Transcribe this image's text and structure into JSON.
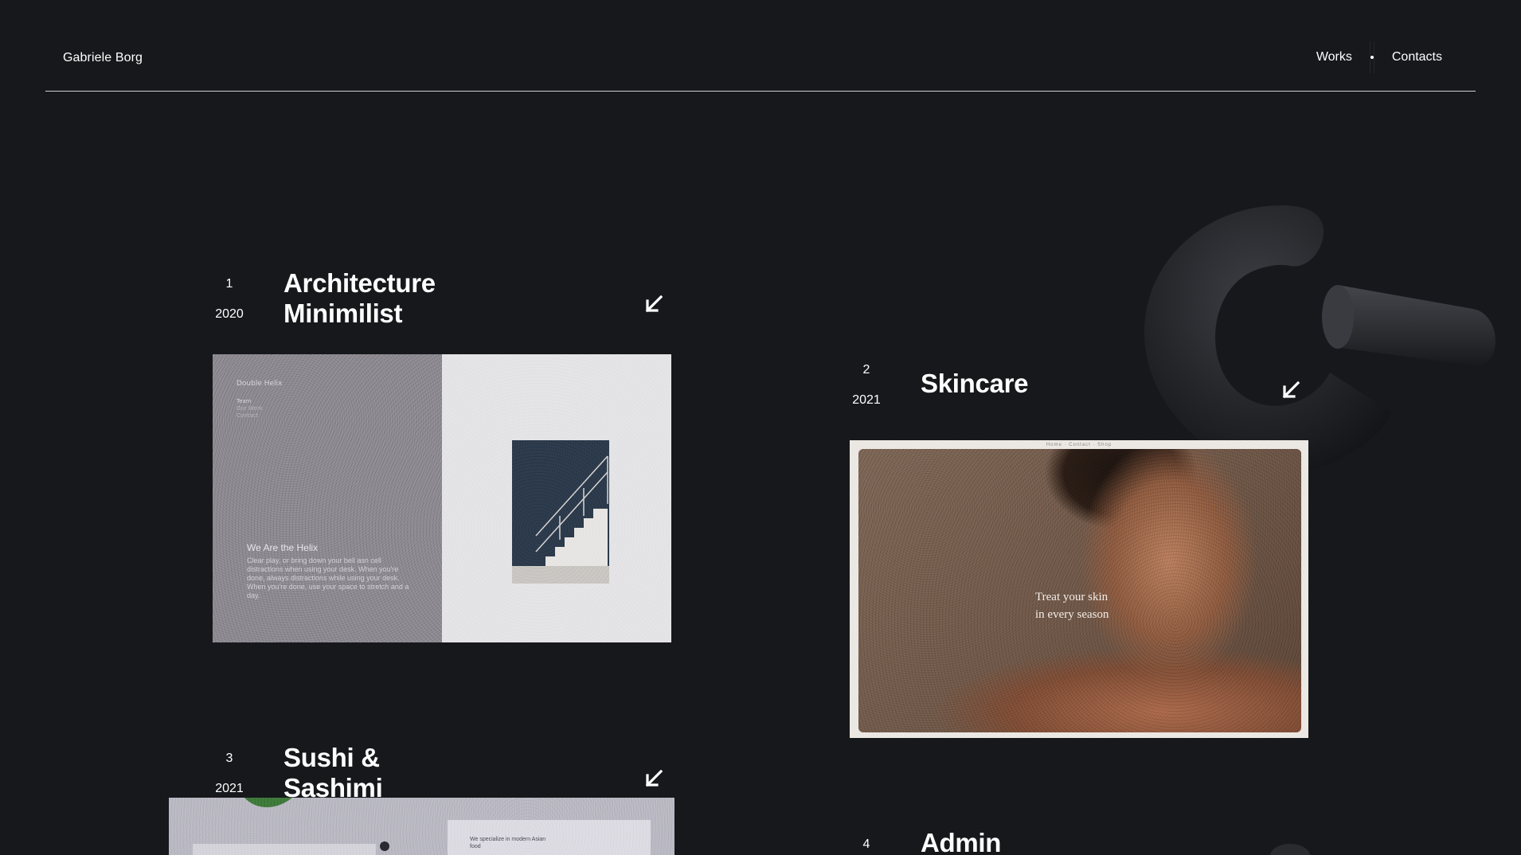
{
  "header": {
    "brand": "Gabriele Borg",
    "nav": [
      {
        "label": "Works"
      },
      {
        "label": "Contacts"
      }
    ]
  },
  "projects": [
    {
      "number": "1",
      "year": "2020",
      "title_lines": [
        "Architecture",
        "Minimilist"
      ],
      "thumb": {
        "brand": "Double Helix",
        "menu": [
          "Team",
          "Our Work",
          "Contact"
        ],
        "heading": "We Are the Helix",
        "body": "Clear play, or bring down your bell asn cell distractions when using your desk. When you're done, always distractions while using your desk. When you're done, use your space to stretch and a day."
      }
    },
    {
      "number": "2",
      "year": "2021",
      "title_lines": [
        "Skincare"
      ],
      "thumb": {
        "nav": "Home  ·  Contact  ·  Shop",
        "tagline_1": "Treat your skin",
        "tagline_2": "in every season"
      }
    },
    {
      "number": "3",
      "year": "2021",
      "title_lines": [
        "Sushi &",
        "Sashimi"
      ],
      "thumb": {
        "card_text": "We specialize in modern Asian food"
      }
    },
    {
      "number": "4",
      "year": "",
      "title_lines": [
        "Admin"
      ]
    }
  ],
  "colors": {
    "background": "#17181c",
    "text": "#ffffff",
    "divider": "#cfcfd2",
    "torus": "#2a2b2f"
  },
  "icons": {
    "project_link": "arrow-down-left-icon"
  }
}
